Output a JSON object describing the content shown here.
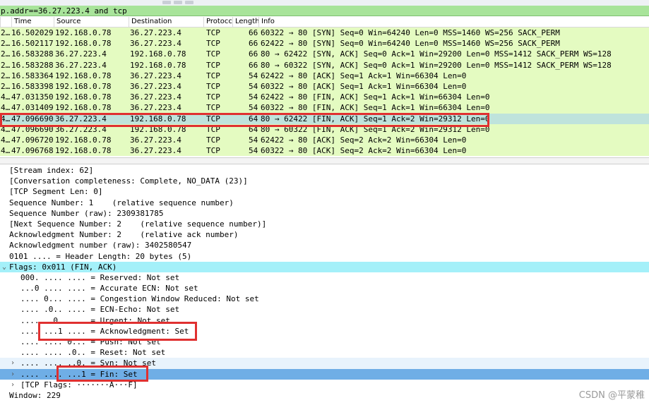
{
  "filter": {
    "expression": "p.addr==36.27.223.4 and tcp"
  },
  "columns": {
    "no": "",
    "time": "Time",
    "source": "Source",
    "destination": "Destination",
    "protocol": "Protocc",
    "length": "Length",
    "info": "Info"
  },
  "packets": [
    {
      "no": "2…",
      "time": "16.502029",
      "source": "192.168.0.78",
      "destination": "36.27.223.4",
      "protocol": "TCP",
      "length": "66",
      "info": "60322 → 80 [SYN] Seq=0 Win=64240 Len=0 MSS=1460 WS=256 SACK_PERM"
    },
    {
      "no": "2…",
      "time": "16.502117",
      "source": "192.168.0.78",
      "destination": "36.27.223.4",
      "protocol": "TCP",
      "length": "66",
      "info": "62422 → 80 [SYN] Seq=0 Win=64240 Len=0 MSS=1460 WS=256 SACK_PERM"
    },
    {
      "no": "2…",
      "time": "16.583288",
      "source": "36.27.223.4",
      "destination": "192.168.0.78",
      "protocol": "TCP",
      "length": "66",
      "info": "80 → 62422 [SYN, ACK] Seq=0 Ack=1 Win=29200 Len=0 MSS=1412 SACK_PERM WS=128"
    },
    {
      "no": "2…",
      "time": "16.583288",
      "source": "36.27.223.4",
      "destination": "192.168.0.78",
      "protocol": "TCP",
      "length": "66",
      "info": "80 → 60322 [SYN, ACK] Seq=0 Ack=1 Win=29200 Len=0 MSS=1412 SACK_PERM WS=128"
    },
    {
      "no": "2…",
      "time": "16.583364",
      "source": "192.168.0.78",
      "destination": "36.27.223.4",
      "protocol": "TCP",
      "length": "54",
      "info": "62422 → 80 [ACK] Seq=1 Ack=1 Win=66304 Len=0"
    },
    {
      "no": "2…",
      "time": "16.583398",
      "source": "192.168.0.78",
      "destination": "36.27.223.4",
      "protocol": "TCP",
      "length": "54",
      "info": "60322 → 80 [ACK] Seq=1 Ack=1 Win=66304 Len=0"
    },
    {
      "no": "4…",
      "time": "47.031350",
      "source": "192.168.0.78",
      "destination": "36.27.223.4",
      "protocol": "TCP",
      "length": "54",
      "info": "62422 → 80 [FIN, ACK] Seq=1 Ack=1 Win=66304 Len=0"
    },
    {
      "no": "4…",
      "time": "47.031409",
      "source": "192.168.0.78",
      "destination": "36.27.223.4",
      "protocol": "TCP",
      "length": "54",
      "info": "60322 → 80 [FIN, ACK] Seq=1 Ack=1 Win=66304 Len=0"
    },
    {
      "no": "4…",
      "time": "47.096690",
      "source": "36.27.223.4",
      "destination": "192.168.0.78",
      "protocol": "TCP",
      "length": "64",
      "info": "80 → 62422 [FIN, ACK] Seq=1 Ack=2 Win=29312 Len=0"
    },
    {
      "no": "4…",
      "time": "47.096690",
      "source": "36.27.223.4",
      "destination": "192.168.0.78",
      "protocol": "TCP",
      "length": "64",
      "info": "80 → 60322 [FIN, ACK] Seq=1 Ack=2 Win=29312 Len=0"
    },
    {
      "no": "4…",
      "time": "47.096720",
      "source": "192.168.0.78",
      "destination": "36.27.223.4",
      "protocol": "TCP",
      "length": "54",
      "info": "62422 → 80 [ACK] Seq=2 Ack=2 Win=66304 Len=0"
    },
    {
      "no": "4…",
      "time": "47.096768",
      "source": "192.168.0.78",
      "destination": "36.27.223.4",
      "protocol": "TCP",
      "length": "54",
      "info": "60322 → 80 [ACK] Seq=2 Ack=2 Win=66304 Len=0"
    }
  ],
  "details": [
    {
      "text": "[Stream index: 62]"
    },
    {
      "text": "[Conversation completeness: Complete, NO_DATA (23)]"
    },
    {
      "text": "[TCP Segment Len: 0]"
    },
    {
      "text": "Sequence Number: 1    (relative sequence number)"
    },
    {
      "text": "Sequence Number (raw): 2309381785"
    },
    {
      "text": "[Next Sequence Number: 2    (relative sequence number)]"
    },
    {
      "text": "Acknowledgment Number: 2    (relative ack number)"
    },
    {
      "text": "Acknowledgment number (raw): 3402580547"
    },
    {
      "text": "0101 .... = Header Length: 20 bytes (5)"
    },
    {
      "text": "Flags: 0x011 (FIN, ACK)"
    },
    {
      "text": "000. .... .... = Reserved: Not set"
    },
    {
      "text": "...0 .... .... = Accurate ECN: Not set"
    },
    {
      "text": ".... 0... .... = Congestion Window Reduced: Not set"
    },
    {
      "text": ".... .0.. .... = ECN-Echo: Not set"
    },
    {
      "text": ".... ..0. .... = Urgent: Not set"
    },
    {
      "text": ".... ...1 .... = Acknowledgment: Set"
    },
    {
      "text": ".... .... 0... = Push: Not set"
    },
    {
      "text": ".... .... .0.. = Reset: Not set"
    },
    {
      "text": ".... .... ..0. = Syn: Not set"
    },
    {
      "text": ".... .... ...1 = Fin: Set"
    },
    {
      "text": "[TCP Flags: ·······A···F]"
    },
    {
      "text": "Window: 229"
    }
  ],
  "icons": {
    "expanded": "chevron-down-icon",
    "collapsed": "chevron-right-icon"
  },
  "colors": {
    "filter_bg": "#a8e49a",
    "packet_bg": "#e4fbc1",
    "selected_bg": "#bfe3dc",
    "flags_bg": "#a4f0f9",
    "fin_bg": "#6faee6",
    "annotation": "#e03030"
  },
  "watermark": "CSDN @平蒙稚"
}
